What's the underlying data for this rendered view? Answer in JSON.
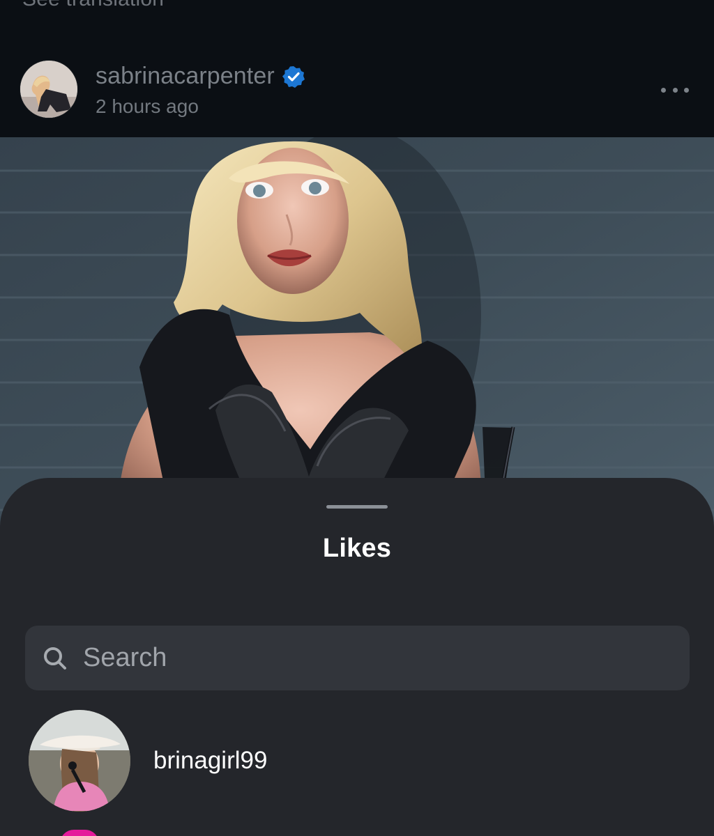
{
  "header": {
    "translation_label": "See translation",
    "username": "sabrinacarpenter",
    "timestamp": "2 hours ago",
    "verified": true
  },
  "post": {
    "has_photo": true
  },
  "likes_sheet": {
    "title": "Likes",
    "search_placeholder": "Search",
    "items": [
      {
        "username": "brinagirl99"
      }
    ]
  },
  "icons": {
    "verified": "verified-badge-icon",
    "more": "more-horizontal-icon",
    "search": "search-icon"
  },
  "colors": {
    "background": "#0b0f14",
    "sheet": "#24262b",
    "search_box": "#32353b",
    "verified_blue": "#1d77d3",
    "text_primary": "#ffffff",
    "text_secondary": "#7b8188"
  }
}
